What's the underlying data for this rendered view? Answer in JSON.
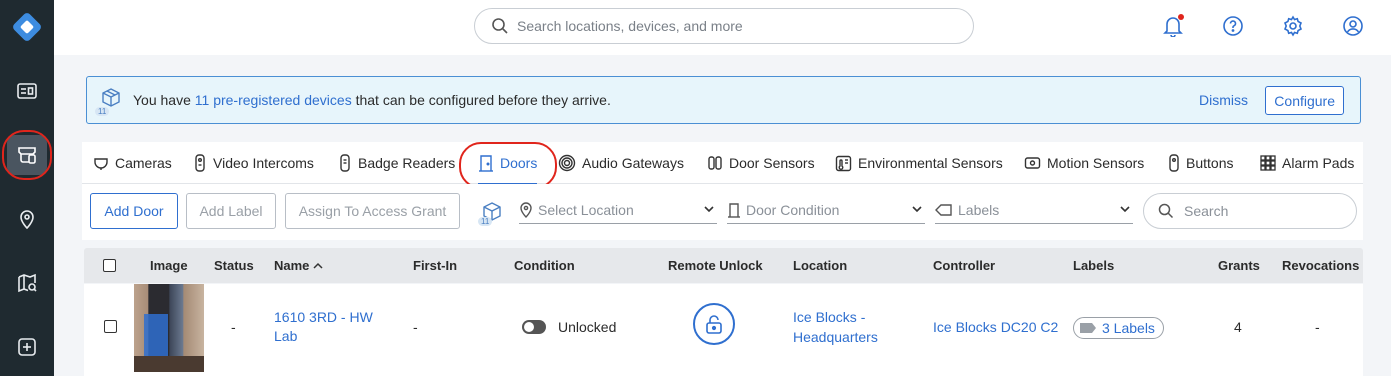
{
  "rail": {
    "items": [
      "logo-icon",
      "dashboard-icon",
      "devices-icon",
      "location-pin-icon",
      "map-search-icon",
      "plus-square-icon"
    ]
  },
  "header": {
    "search_placeholder": "Search locations, devices, and more",
    "icons": [
      "bell-icon",
      "help-icon",
      "gear-icon",
      "user-icon"
    ]
  },
  "banner": {
    "badge": "11",
    "text_before": "You have ",
    "link_text": "11 pre-registered devices",
    "text_after": " that can be configured before they arrive.",
    "dismiss": "Dismiss",
    "configure": "Configure"
  },
  "tabs": [
    {
      "label": "Cameras"
    },
    {
      "label": "Video Intercoms"
    },
    {
      "label": "Badge Readers"
    },
    {
      "label": "Doors"
    },
    {
      "label": "Audio Gateways"
    },
    {
      "label": "Door Sensors"
    },
    {
      "label": "Environmental Sensors"
    },
    {
      "label": "Motion Sensors"
    },
    {
      "label": "Buttons"
    },
    {
      "label": "Alarm Pads"
    }
  ],
  "toolbar": {
    "add_door": "Add Door",
    "add_label": "Add Label",
    "assign": "Assign To Access Grant",
    "badge": "11",
    "select_location": "Select Location",
    "door_condition": "Door Condition",
    "labels": "Labels",
    "search_placeholder": "Search"
  },
  "table": {
    "headers": {
      "image": "Image",
      "status": "Status",
      "name": "Name",
      "first_in": "First-In",
      "condition": "Condition",
      "remote_unlock": "Remote Unlock",
      "location": "Location",
      "controller": "Controller",
      "labels": "Labels",
      "grants": "Grants",
      "revocations": "Revocations"
    },
    "rows": [
      {
        "status": "-",
        "name": "1610 3RD - HW Lab",
        "first_in": "-",
        "condition": "Unlocked",
        "location": "Ice Blocks - Headquarters",
        "controller": "Ice Blocks DC20 C2",
        "labels": "3 Labels",
        "grants": "4",
        "revocations": "-"
      }
    ]
  },
  "colors": {
    "accent": "#2f6fcf",
    "rail": "#1f2a30",
    "highlight_ring": "#e0251c",
    "banner_bg": "#e7f5fb"
  }
}
